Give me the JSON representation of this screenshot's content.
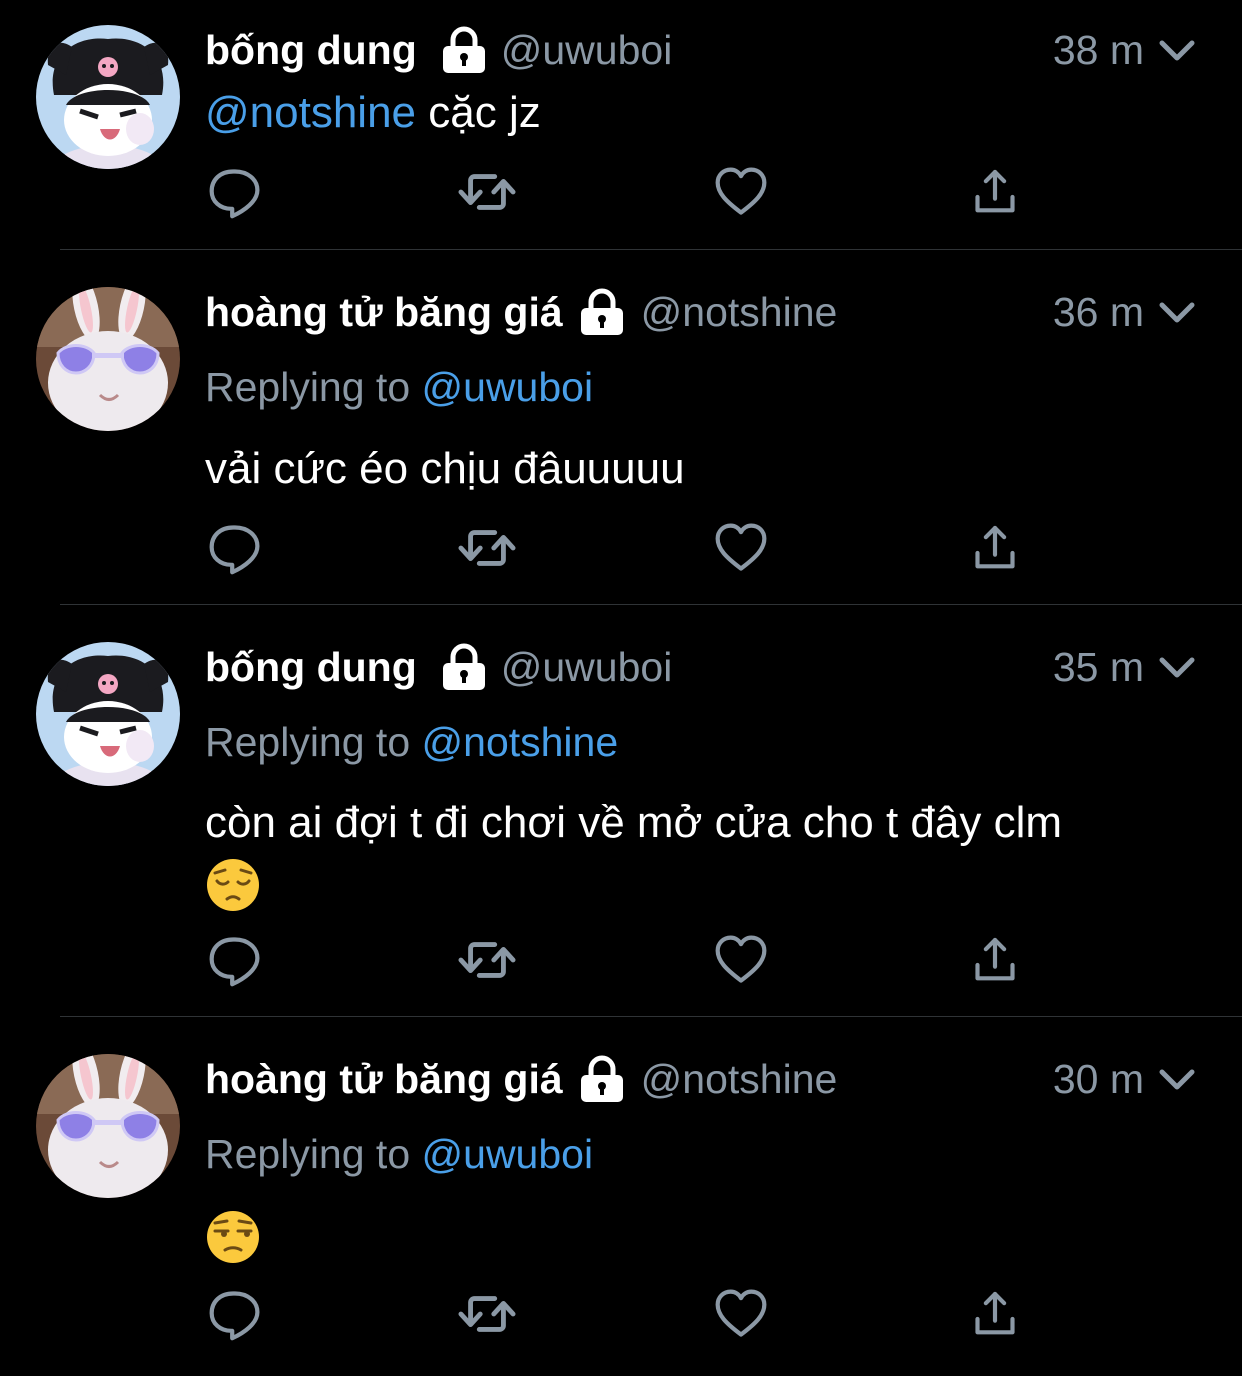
{
  "colors": {
    "background": "#000000",
    "text": "#ffffff",
    "muted": "#8b98a5",
    "link": "#4a9fe8",
    "divider": "#2f3336"
  },
  "tweets": [
    {
      "name": "bống dung",
      "handle": "@uwuboi",
      "time": "38 m",
      "avatar": "kuromi-avatar",
      "mention": "@notshine",
      "text": " cặc jz"
    },
    {
      "name": "hoàng tử băng giá",
      "handle": "@notshine",
      "time": "36 m",
      "avatar": "bunny-avatar",
      "replying_label": "Replying to ",
      "replying_to": "@uwuboi",
      "text": "vải cức éo chịu đâuuuuu"
    },
    {
      "name": "bống dung",
      "handle": "@uwuboi",
      "time": "35 m",
      "avatar": "kuromi-avatar",
      "replying_label": "Replying to ",
      "replying_to": "@notshine",
      "text": "còn ai đợi t đi chơi về mở cửa cho t đây clm",
      "emoji": "pensive-face"
    },
    {
      "name": "hoàng tử băng giá",
      "handle": "@notshine",
      "time": "30 m",
      "avatar": "bunny-avatar",
      "replying_label": "Replying to ",
      "replying_to": "@uwuboi",
      "emoji": "unamused-face"
    }
  ],
  "icons": {
    "lock": "lock-icon",
    "chevron": "chevron-down-icon",
    "reply": "reply-icon",
    "retweet": "retweet-icon",
    "like": "heart-icon",
    "share": "share-icon"
  }
}
